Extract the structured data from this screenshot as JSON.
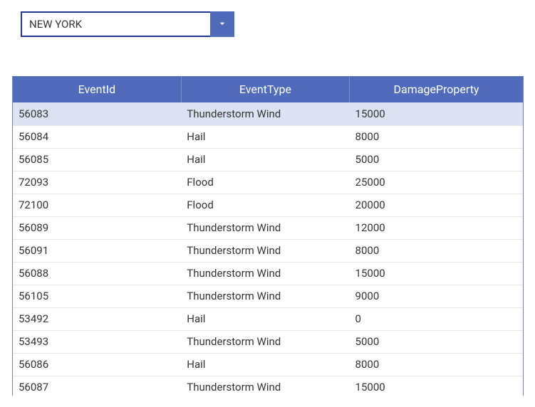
{
  "dropdown": {
    "value": "NEW YORK"
  },
  "table": {
    "headers": {
      "eventId": "EventId",
      "eventType": "EventType",
      "damageProperty": "DamageProperty"
    },
    "rows": [
      {
        "eventId": "56083",
        "eventType": "Thunderstorm Wind",
        "damageProperty": "15000"
      },
      {
        "eventId": "56084",
        "eventType": "Hail",
        "damageProperty": "8000"
      },
      {
        "eventId": "56085",
        "eventType": "Hail",
        "damageProperty": "5000"
      },
      {
        "eventId": "72093",
        "eventType": "Flood",
        "damageProperty": "25000"
      },
      {
        "eventId": "72100",
        "eventType": "Flood",
        "damageProperty": "20000"
      },
      {
        "eventId": "56089",
        "eventType": "Thunderstorm Wind",
        "damageProperty": "12000"
      },
      {
        "eventId": "56091",
        "eventType": "Thunderstorm Wind",
        "damageProperty": "8000"
      },
      {
        "eventId": "56088",
        "eventType": "Thunderstorm Wind",
        "damageProperty": "15000"
      },
      {
        "eventId": "56105",
        "eventType": "Thunderstorm Wind",
        "damageProperty": "9000"
      },
      {
        "eventId": "53492",
        "eventType": "Hail",
        "damageProperty": "0"
      },
      {
        "eventId": "53493",
        "eventType": "Thunderstorm Wind",
        "damageProperty": "5000"
      },
      {
        "eventId": "56086",
        "eventType": "Hail",
        "damageProperty": "8000"
      },
      {
        "eventId": "56087",
        "eventType": "Thunderstorm Wind",
        "damageProperty": "15000"
      }
    ]
  }
}
